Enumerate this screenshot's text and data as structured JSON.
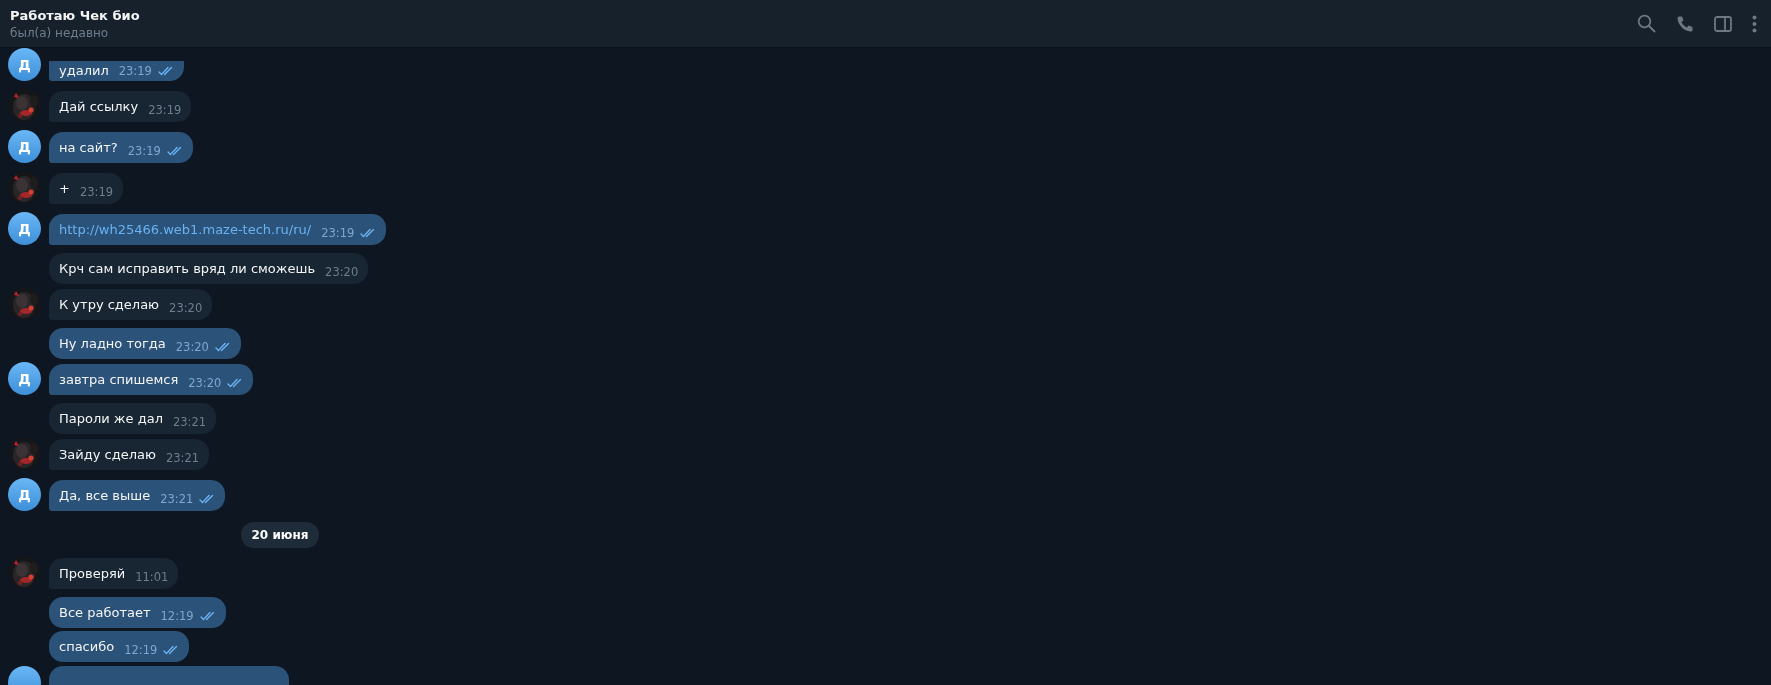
{
  "header": {
    "title": "Работаю Чек био",
    "status": "был(а) недавно"
  },
  "messages": [
    {
      "kind": "outgoing",
      "text": "удалил",
      "time": "23:19",
      "read": true,
      "avatar": {
        "kind": "letter",
        "letter": "Д"
      }
    },
    {
      "kind": "incoming",
      "text": "Дай ссылку",
      "time": "23:19"
    },
    {
      "kind": "outgoing",
      "text": "на сайт?",
      "time": "23:19",
      "read": true,
      "avatar": {
        "kind": "letter",
        "letter": "Д"
      }
    },
    {
      "kind": "incoming",
      "text": "+",
      "time": "23:19"
    },
    {
      "kind": "outgoing_link",
      "text": "http://wh25466.web1.maze-tech.ru/ru/",
      "time": "23:19",
      "read": true,
      "avatar": {
        "kind": "letter",
        "letter": "Д"
      }
    },
    {
      "kind": "incoming",
      "text": "Крч сам исправить вряд ли сможешь",
      "time": "23:20"
    },
    {
      "kind": "incoming",
      "text": "К утру сделаю",
      "time": "23:20"
    },
    {
      "kind": "outgoing",
      "text": "Ну ладно тогда",
      "time": "23:20",
      "read": true
    },
    {
      "kind": "outgoing",
      "text": "завтра спишемся",
      "time": "23:20",
      "read": true,
      "avatar": {
        "kind": "letter",
        "letter": "Д"
      }
    },
    {
      "kind": "incoming",
      "text": "Пароли же дал",
      "time": "23:21"
    },
    {
      "kind": "incoming",
      "text": "Зайду сделаю",
      "time": "23:21"
    },
    {
      "kind": "outgoing",
      "text": "Да, все выше",
      "time": "23:21",
      "read": true,
      "avatar": {
        "kind": "letter",
        "letter": "Д"
      }
    },
    {
      "kind": "date",
      "text": "20 июня"
    },
    {
      "kind": "incoming",
      "text": "Проверяй",
      "time": "11:01"
    },
    {
      "kind": "outgoing",
      "text": "Все работает",
      "time": "12:19",
      "read": true
    },
    {
      "kind": "outgoing",
      "text": "спасибо",
      "time": "12:19",
      "read": true
    },
    {
      "kind": "outgoing_cut",
      "avatar": {
        "kind": "circle"
      }
    }
  ]
}
